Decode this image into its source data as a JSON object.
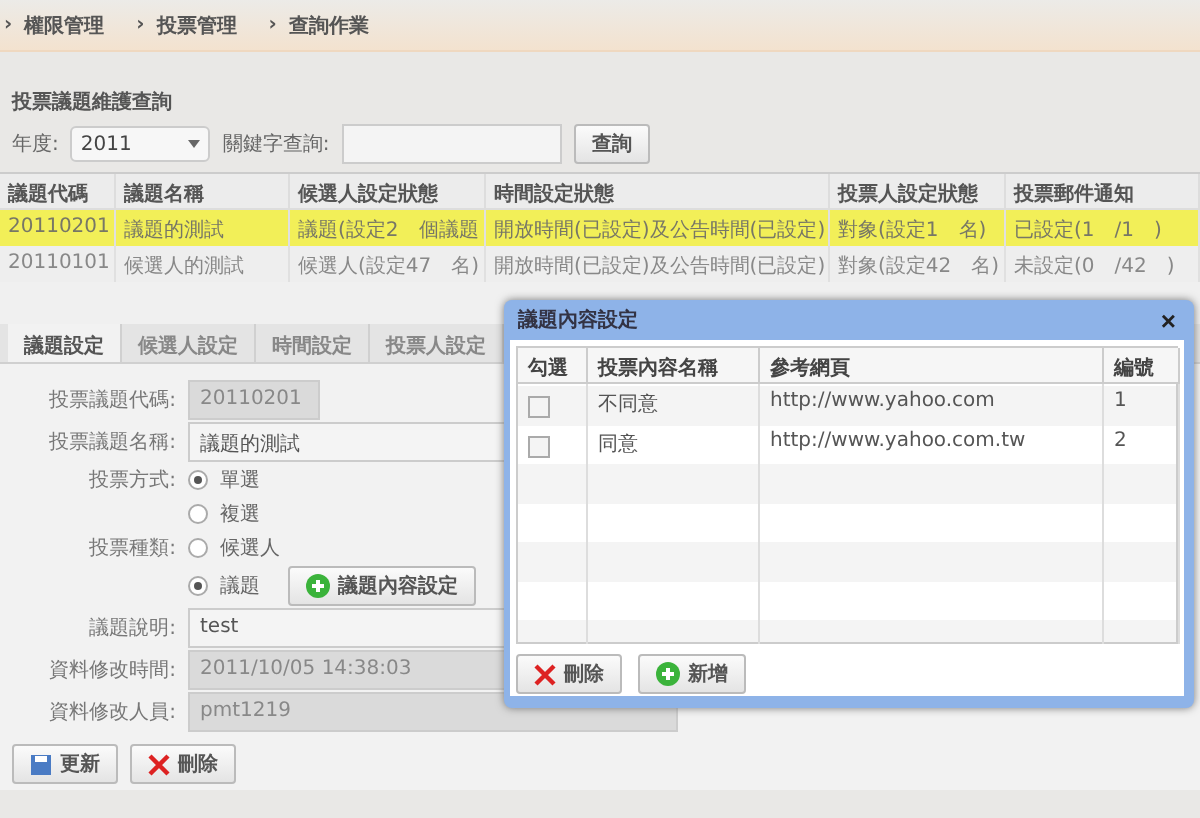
{
  "breadcrumb": [
    {
      "arrow": "›",
      "label": "權限管理"
    },
    {
      "arrow": "›",
      "label": "投票管理"
    },
    {
      "arrow": "›",
      "label": "查詢作業"
    }
  ],
  "search": {
    "title": "投票議題維護查詢",
    "year_label": "年度:",
    "year": "2011",
    "keyword_label": "關鍵字查詢:",
    "button": "查詢"
  },
  "table": {
    "columns": [
      "議題代碼",
      "議題名稱",
      "候選人設定狀態",
      "時間設定狀態",
      "投票人設定狀態",
      "投票郵件通知"
    ],
    "rows": [
      {
        "selected": true,
        "cells": [
          "20110201",
          "議題的測試",
          "議題(設定2　個議題",
          "開放時間(已設定)及公告時間(已設定)",
          "對象(設定1　名)",
          "已設定(1　/1　)"
        ]
      },
      {
        "selected": false,
        "cells": [
          "20110101",
          "候選人的測試",
          "候選人(設定47　名)",
          "開放時間(已設定)及公告時間(已設定)",
          "對象(設定42　名)",
          "未設定(0　/42　)"
        ]
      }
    ]
  },
  "tabs": [
    {
      "label": "議題設定",
      "selected": true
    },
    {
      "label": "候選人設定",
      "selected": false
    },
    {
      "label": "時間設定",
      "selected": false
    },
    {
      "label": "投票人設定",
      "selected": false
    }
  ],
  "form": [
    {
      "kind": "short_field",
      "label": "投票議題代碼:",
      "value": "20110201",
      "disabled": true
    },
    {
      "kind": "field",
      "label": "投票議題名稱:",
      "value": "議題的測試",
      "disabled": false
    },
    {
      "kind": "radio",
      "label": "投票方式:",
      "option": "單選",
      "selected": true
    },
    {
      "kind": "radio",
      "option": "複選",
      "selected": false
    },
    {
      "kind": "radio",
      "label": "投票種類:",
      "option": "候選人",
      "selected": false
    },
    {
      "kind": "radio",
      "option": "議題",
      "selected": true,
      "button": "議題內容設定"
    },
    {
      "kind": "field",
      "label": "議題說明:",
      "value": "test",
      "disabled": false
    },
    {
      "kind": "field",
      "label": "資料修改時間:",
      "value": "2011/10/05 14:38:03",
      "disabled": true
    },
    {
      "kind": "field",
      "label": "資料修改人員:",
      "value": "pmt1219",
      "disabled": true
    }
  ],
  "form_buttons": [
    {
      "kind": "save",
      "label": "更新"
    },
    {
      "kind": "delete",
      "label": "刪除"
    }
  ],
  "dialog": {
    "title": "議題內容設定",
    "close": "×",
    "columns": [
      "勾選",
      "投票內容名稱",
      "參考網頁",
      "編號"
    ],
    "rows": [
      {
        "checked": false,
        "name": "不同意",
        "url": "http://www.yahoo.com",
        "number": "1"
      },
      {
        "checked": false,
        "name": "同意",
        "url": "http://www.yahoo.com.tw",
        "number": "2"
      }
    ],
    "buttons": [
      {
        "kind": "delete",
        "label": "刪除"
      },
      {
        "kind": "add",
        "label": "新增"
      }
    ]
  }
}
